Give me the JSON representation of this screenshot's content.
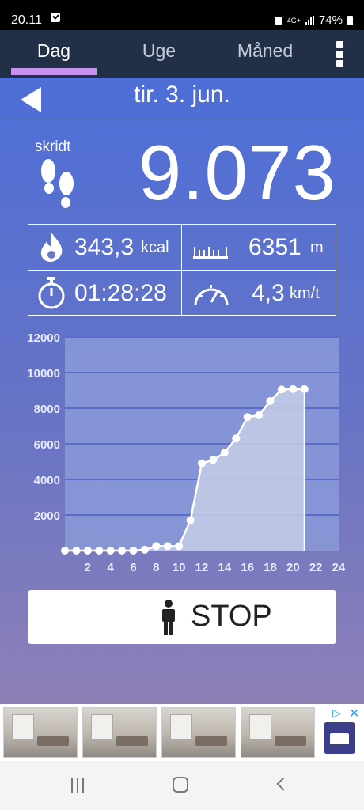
{
  "status_bar": {
    "time": "20.11",
    "network": "4G+",
    "battery": "74%"
  },
  "tabs": [
    {
      "label": "Dag",
      "active": true
    },
    {
      "label": "Uge",
      "active": false
    },
    {
      "label": "Måned",
      "active": false
    }
  ],
  "date_nav": {
    "title": "tir. 3. jun."
  },
  "steps": {
    "label": "skridt",
    "value": "9.073"
  },
  "stats": {
    "calories": {
      "value": "343,3",
      "unit": "kcal"
    },
    "distance": {
      "value": "6351",
      "unit": "m"
    },
    "duration": {
      "value": "01:28:28"
    },
    "speed": {
      "value": "4,3",
      "unit": "km/t"
    }
  },
  "chart_data": {
    "type": "area",
    "x": [
      0,
      1,
      2,
      3,
      4,
      5,
      6,
      7,
      8,
      9,
      10,
      11,
      12,
      13,
      14,
      15,
      16,
      17,
      18,
      19,
      20,
      21
    ],
    "y": [
      0,
      0,
      0,
      0,
      0,
      0,
      0,
      50,
      250,
      250,
      250,
      1700,
      4900,
      5100,
      5500,
      6300,
      7500,
      7600,
      8400,
      9050,
      9073,
      9073
    ],
    "xlim": [
      0,
      24
    ],
    "ylim": [
      0,
      12000
    ],
    "xticks": [
      "2",
      "4",
      "6",
      "8",
      "10",
      "12",
      "14",
      "16",
      "18",
      "20",
      "22",
      "24"
    ],
    "yticks": [
      "2000",
      "4000",
      "6000",
      "8000",
      "10000",
      "12000"
    ],
    "grid": true,
    "colors": {
      "line": "#ffffff",
      "fill": "#c7cee6",
      "plot_bg": "#8a9ad8",
      "grid": "#5d6bc6"
    }
  },
  "stop_button": {
    "label": "STOP"
  },
  "nav_bar": {
    "icons": [
      "recents-icon",
      "home-icon",
      "back-icon"
    ]
  }
}
